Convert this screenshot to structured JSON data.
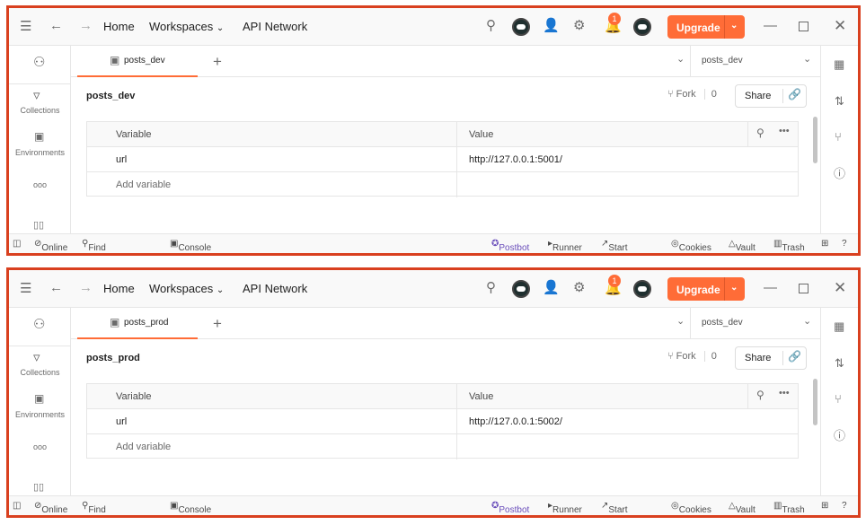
{
  "panels": [
    {
      "header": {
        "home": "Home",
        "workspaces": "Workspaces",
        "api_network": "API Network",
        "notification_count": "1",
        "upgrade": "Upgrade"
      },
      "sidebar": {
        "collections": "Collections",
        "environments": "Environments",
        "more": "ooo"
      },
      "tab": {
        "label": "posts_dev",
        "plus": "+"
      },
      "environment_select": "posts_dev",
      "title": "posts_dev",
      "fork": {
        "label": "Fork",
        "count": "0"
      },
      "share": "Share",
      "table": {
        "headers": [
          "Variable",
          "Value"
        ],
        "rows": [
          {
            "variable": "url",
            "value": "http://127.0.0.1:5001/"
          }
        ],
        "add_variable": "Add variable"
      },
      "status": {
        "online": "Online",
        "find_replace": "Find and replace",
        "console": "Console",
        "postbot": "Postbot",
        "runner": "Runner",
        "start_proxy": "Start Proxy",
        "cookies": "Cookies",
        "vault": "Vault",
        "trash": "Trash"
      }
    },
    {
      "header": {
        "home": "Home",
        "workspaces": "Workspaces",
        "api_network": "API Network",
        "notification_count": "1",
        "upgrade": "Upgrade"
      },
      "sidebar": {
        "collections": "Collections",
        "environments": "Environments",
        "more": "ooo"
      },
      "tab": {
        "label": "posts_prod",
        "plus": "+"
      },
      "environment_select": "posts_dev",
      "title": "posts_prod",
      "fork": {
        "label": "Fork",
        "count": "0"
      },
      "share": "Share",
      "table": {
        "headers": [
          "Variable",
          "Value"
        ],
        "rows": [
          {
            "variable": "url",
            "value": "http://127.0.0.1:5002/"
          }
        ],
        "add_variable": "Add variable"
      },
      "status": {
        "online": "Online",
        "find_replace": "Find and replace",
        "console": "Console",
        "postbot": "Postbot",
        "runner": "Runner",
        "start_proxy": "Start Proxy",
        "cookies": "Cookies",
        "vault": "Vault",
        "trash": "Trash"
      }
    }
  ],
  "colors": {
    "accent": "#ff6c37",
    "frame": "#d9401f",
    "postbot": "#6b4fbb"
  }
}
